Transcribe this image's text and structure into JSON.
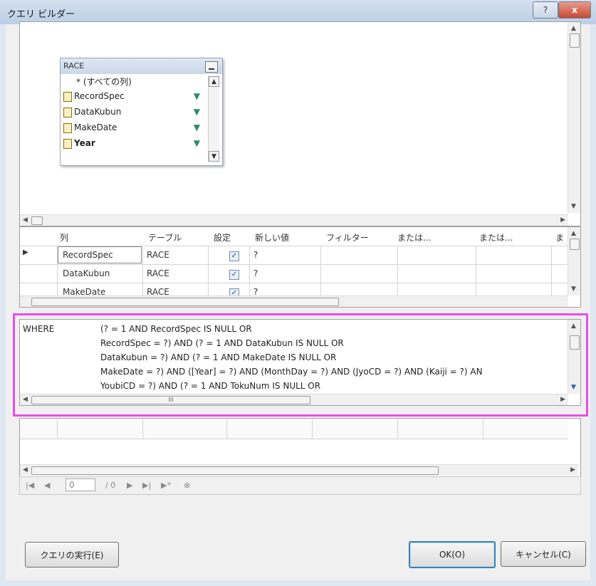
{
  "window": {
    "title": "クエリ ビルダー",
    "help_glyph": "?",
    "close_glyph": "x"
  },
  "diagram": {
    "table": {
      "name": "RACE",
      "all_columns": "* (すべての列)",
      "columns": [
        "RecordSpec",
        "DataKubun",
        "MakeDate",
        "Year"
      ],
      "filter_icon": "funnel-icon"
    }
  },
  "grid": {
    "headers": [
      "列",
      "テーブル",
      "設定",
      "新しい値",
      "フィルター",
      "または...",
      "または...",
      "ま"
    ],
    "rows": [
      {
        "column": "RecordSpec",
        "table": "RACE",
        "checked": "✓",
        "value": "?"
      },
      {
        "column": "DataKubun",
        "table": "RACE",
        "checked": "✓",
        "value": "?"
      },
      {
        "column": "MakeDate",
        "table": "RACE",
        "checked": "✓",
        "value": "?"
      }
    ]
  },
  "sql": {
    "keyword": "WHERE",
    "lines": [
      "(? = 1 AND RecordSpec IS NULL OR",
      "RecordSpec = ?) AND (? = 1 AND DataKubun IS NULL OR",
      "DataKubun = ?) AND (? = 1 AND MakeDate IS NULL OR",
      "MakeDate = ?) AND ([Year] = ?) AND (MonthDay = ?) AND (JyoCD = ?) AND (Kaiji = ?) AN",
      "YoubiCD = ?) AND (? = 1 AND TokuNum IS NULL OR"
    ],
    "scroll_glyph": "III"
  },
  "navigator": {
    "position_value": "0",
    "of_total": "/ 0"
  },
  "buttons": {
    "execute": "クエリの実行(E)",
    "ok": "OK(O)",
    "cancel": "キャンセル(C)"
  },
  "colors": {
    "highlight": "#ea4ee8"
  }
}
